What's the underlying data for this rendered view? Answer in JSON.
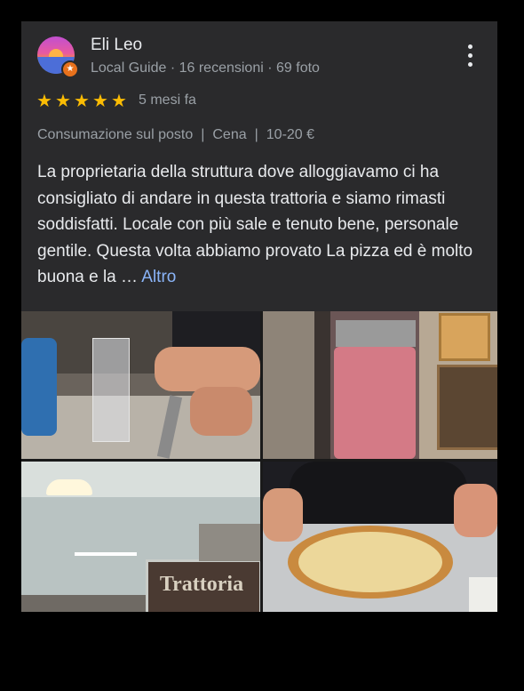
{
  "review": {
    "author_name": "Eli Leo",
    "author_meta": "Local Guide · 16 recensioni · 69 foto",
    "rating": 5,
    "stars": [
      "★",
      "★",
      "★",
      "★",
      "★"
    ],
    "time_ago": "5 mesi fa",
    "attributes": [
      "Consumazione sul posto",
      "Cena",
      "10-20 €"
    ],
    "attribute_separator": "|",
    "text": "La proprietaria della struttura dove alloggiavamo ci ha consigliato di andare in questa trattoria e siamo rimasti soddisfatti. Locale con più sale e tenuto bene, personale gentile. Questa volta abbiamo provato La pizza ed è molto buona e la … ",
    "more_label": "Altro",
    "badge_glyph": "★"
  },
  "photos": [
    {
      "name": "photo-table-glass"
    },
    {
      "name": "photo-kitchen-meat"
    },
    {
      "name": "photo-trattoria-sign",
      "sign_text": "Trattoria"
    },
    {
      "name": "photo-pizza"
    }
  ],
  "colors": {
    "background": "#000000",
    "card": "#2a2a2c",
    "text_primary": "#e8eaed",
    "text_secondary": "#9aa0a6",
    "star": "#fbbc04",
    "link": "#8ab4f8",
    "badge": "#e8711c"
  }
}
